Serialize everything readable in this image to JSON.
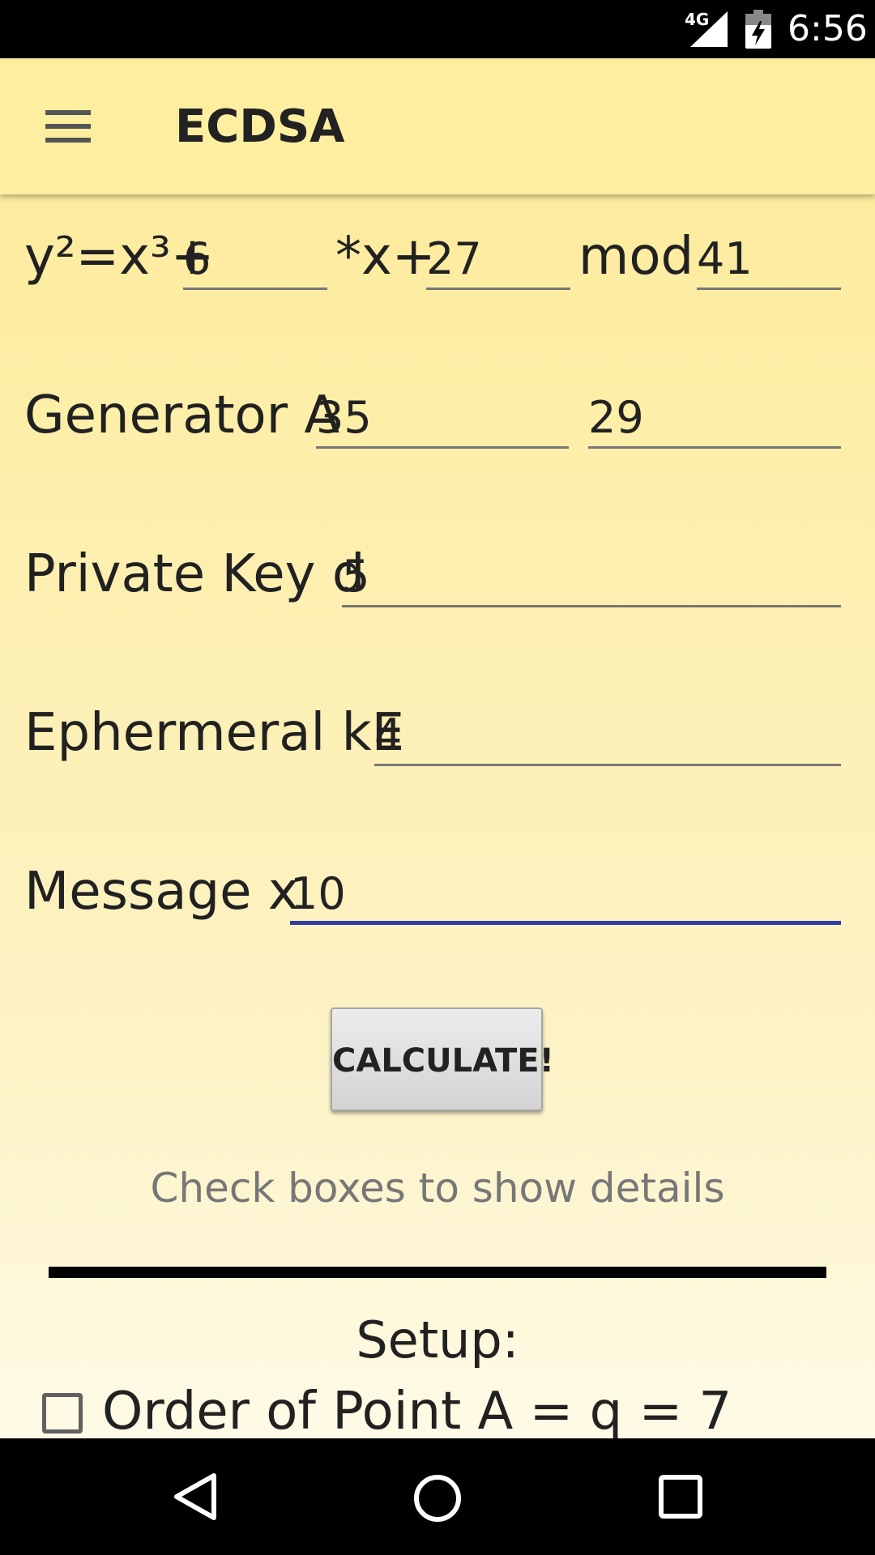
{
  "status_bar": {
    "network": "4G",
    "time": "6:56"
  },
  "app_bar": {
    "title": "ECDSA"
  },
  "curve": {
    "prefix": "y²=x³+",
    "a": "6",
    "x_term": "*x+",
    "b": "27",
    "mod_label": "mod",
    "p": "41"
  },
  "generator": {
    "label": "Generator A",
    "x": "35",
    "y": "29"
  },
  "private_key": {
    "label": "Private Key d",
    "value": "5"
  },
  "ephemeral": {
    "label": "Ephermeral kE",
    "value": "4"
  },
  "message": {
    "label": "Message x",
    "value": "10"
  },
  "calculate_label": "CALCULATE!",
  "hint": "Check boxes to show details",
  "setup": {
    "heading": "Setup:",
    "order_label": "Order of Point A = q = 7",
    "order_checked": false
  },
  "colors": {
    "app_bar": "#fdeea0",
    "accent": "#303f9f"
  }
}
